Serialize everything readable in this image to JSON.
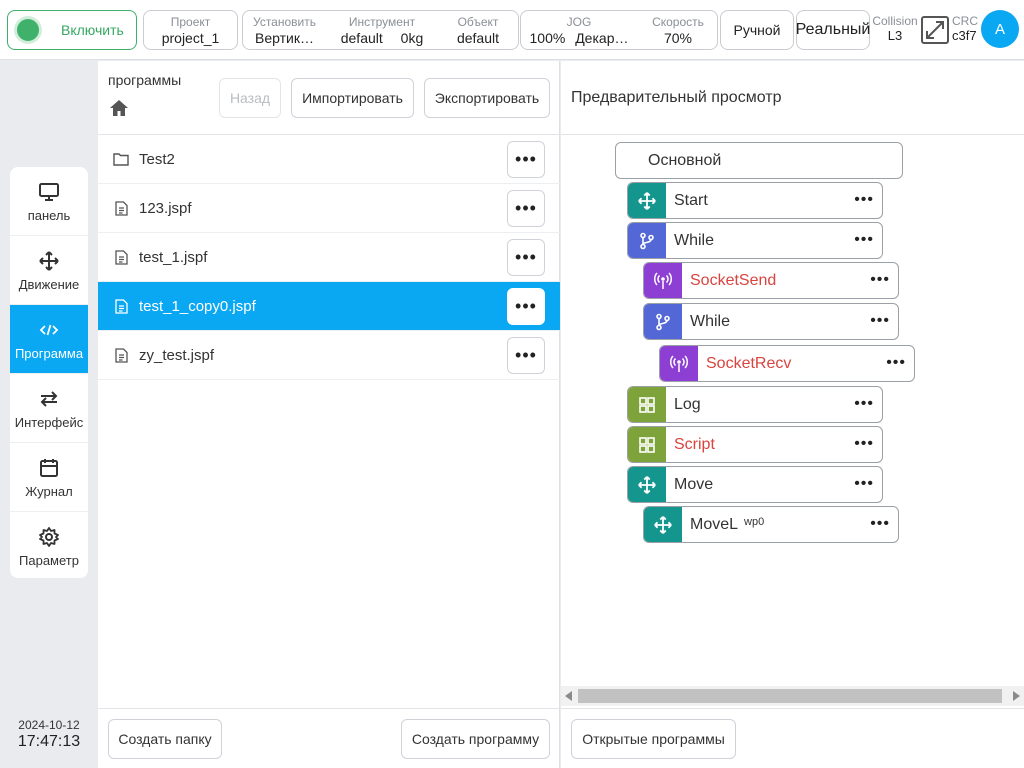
{
  "header": {
    "enable_label": "Включить",
    "project": {
      "label": "Проект",
      "value": "project_1"
    },
    "install": {
      "label": "Установить",
      "value": "Вертик…"
    },
    "tool": {
      "label": "Инструмент",
      "value": "default",
      "weight": "0kg"
    },
    "object": {
      "label": "Объект",
      "value": "default"
    },
    "jog": {
      "label": "JOG",
      "value": "100%",
      "frame": "Декар…"
    },
    "speed": {
      "label": "Скорость",
      "value": "70%"
    },
    "mode_manual": "Ручной",
    "mode_real": "Реальный",
    "collision": {
      "label": "Collision",
      "value": "L3"
    },
    "crc": {
      "label": "CRC",
      "value": "c3f7"
    },
    "avatar": "A"
  },
  "sidebar": {
    "items": [
      {
        "label": "панель",
        "icon": "monitor-icon"
      },
      {
        "label": "Движение",
        "icon": "move-icon"
      },
      {
        "label": "Программа",
        "icon": "code-icon",
        "active": true
      },
      {
        "label": "Интерфейс",
        "icon": "swap-icon"
      },
      {
        "label": "Журнал",
        "icon": "calendar-icon"
      },
      {
        "label": "Параметр",
        "icon": "gear-icon"
      }
    ],
    "date": "2024-10-12",
    "time": "17:47:13"
  },
  "files": {
    "title": "программы",
    "back": "Назад",
    "import": "Импортировать",
    "export": "Экспортировать",
    "items": [
      {
        "name": "Test2",
        "type": "folder"
      },
      {
        "name": "123.jspf",
        "type": "file"
      },
      {
        "name": "test_1.jspf",
        "type": "file"
      },
      {
        "name": "test_1_copy0.jspf",
        "type": "file",
        "selected": true
      },
      {
        "name": "zy_test.jspf",
        "type": "file"
      }
    ],
    "more": "•••",
    "create_folder": "Создать папку",
    "create_program": "Создать программу"
  },
  "preview": {
    "title": "Предварительный просмотр",
    "root": "Основной",
    "nodes": [
      {
        "label": "Start",
        "icon": "move-icon",
        "color": "#14968f"
      },
      {
        "label": "While",
        "icon": "branch-icon",
        "color": "#5467d6"
      },
      {
        "label": "SocketSend",
        "icon": "antenna-icon",
        "color": "#8e3fd3",
        "red": true
      },
      {
        "label": "While",
        "icon": "branch-icon",
        "color": "#5467d6"
      },
      {
        "label": "SocketRecv",
        "icon": "antenna-icon",
        "color": "#8e3fd3",
        "red": true
      },
      {
        "label": "Log",
        "icon": "grid-icon",
        "color": "#7ea33a"
      },
      {
        "label": "Script",
        "icon": "grid-icon",
        "color": "#7ea33a",
        "red": true
      },
      {
        "label": "Move",
        "icon": "move-icon",
        "color": "#14968f"
      },
      {
        "label": "MoveL",
        "sub": "wp0",
        "icon": "move-icon",
        "color": "#14968f"
      }
    ],
    "dots": "•••",
    "open_programs": "Открытые программы"
  },
  "colors": {
    "accent": "#0aa7f2",
    "enable_green": "#3fb16b",
    "error_red": "#d9443f"
  }
}
